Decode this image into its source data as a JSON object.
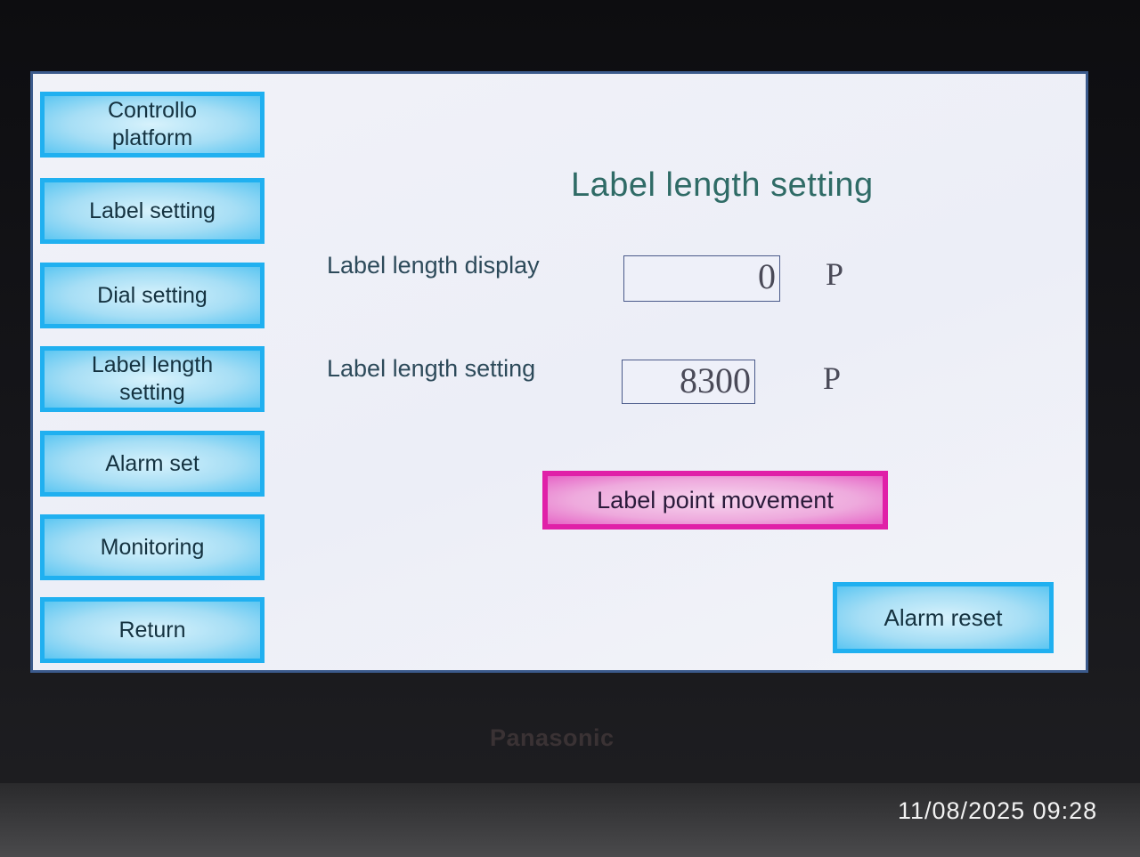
{
  "sidebar": {
    "items": [
      {
        "label": "Controllo\nplatform"
      },
      {
        "label": "Label setting"
      },
      {
        "label": "Dial setting"
      },
      {
        "label": "Label length\nsetting"
      },
      {
        "label": "Alarm set"
      },
      {
        "label": "Monitoring"
      },
      {
        "label": "Return"
      }
    ]
  },
  "main": {
    "title": "Label length setting",
    "display": {
      "label": "Label length display",
      "value": "0",
      "unit": "P"
    },
    "setting": {
      "label": "Label length setting",
      "value": "8300",
      "unit": "P"
    },
    "label_point_button": "Label point movement",
    "alarm_reset_button": "Alarm reset"
  },
  "device": {
    "brand": "Panasonic"
  },
  "photo": {
    "timestamp": "11/08/2025 09:28"
  },
  "colors": {
    "nav_button_border": "#20b0f0",
    "nav_button_fill": "#a6def5",
    "action_button_border": "#e020a8",
    "action_button_fill": "#eeaadd",
    "title_text": "#2f6b66",
    "screen_background": "#eceef7"
  }
}
